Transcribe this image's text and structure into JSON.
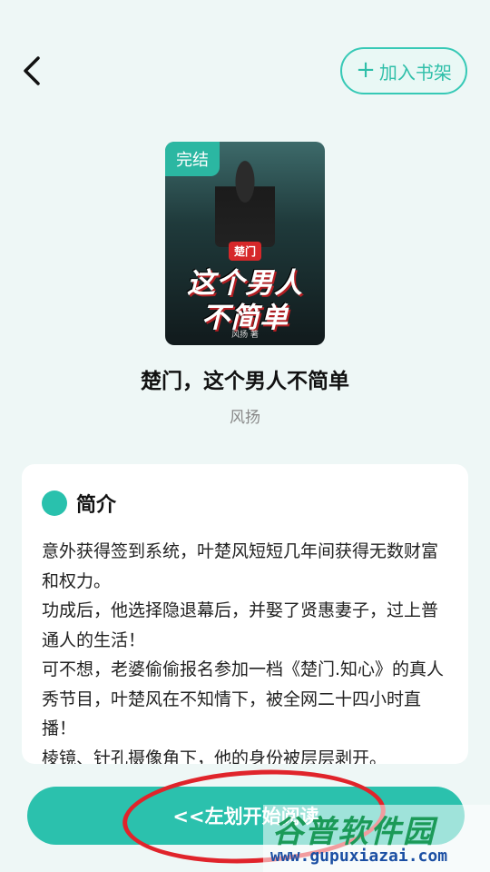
{
  "header": {
    "back_icon": "chevron-left-icon",
    "add_to_shelf_icon": "plus",
    "add_to_shelf_label": "加入书架",
    "accent_color": "#2bc1ad"
  },
  "book": {
    "cover": {
      "status_badge": "完结",
      "series_tag": "楚门",
      "title_line1": "这个男人",
      "title_line2": "不简单",
      "author": "风扬 著"
    },
    "title": "楚门，这个男人不简单",
    "author": "风扬"
  },
  "intro": {
    "label": "简介",
    "paragraphs": [
      "意外获得签到系统，叶楚风短短几年间获得无数财富和权力。",
      "功成后，他选择隐退幕后，并娶了贤惠妻子，过上普通人的生活！",
      "可不想，老婆偷偷报名参加一档《楚门.知心》的真人秀节目，叶楚风在不知情下，被全网二十四小时直播！",
      "棱镜、针孔摄像角下，他的身份被层层剥开。"
    ]
  },
  "read_button": {
    "label": "<<左划开始阅读"
  },
  "watermark": {
    "main": "谷普软件园",
    "url": "www.gupuxiazai.com"
  }
}
